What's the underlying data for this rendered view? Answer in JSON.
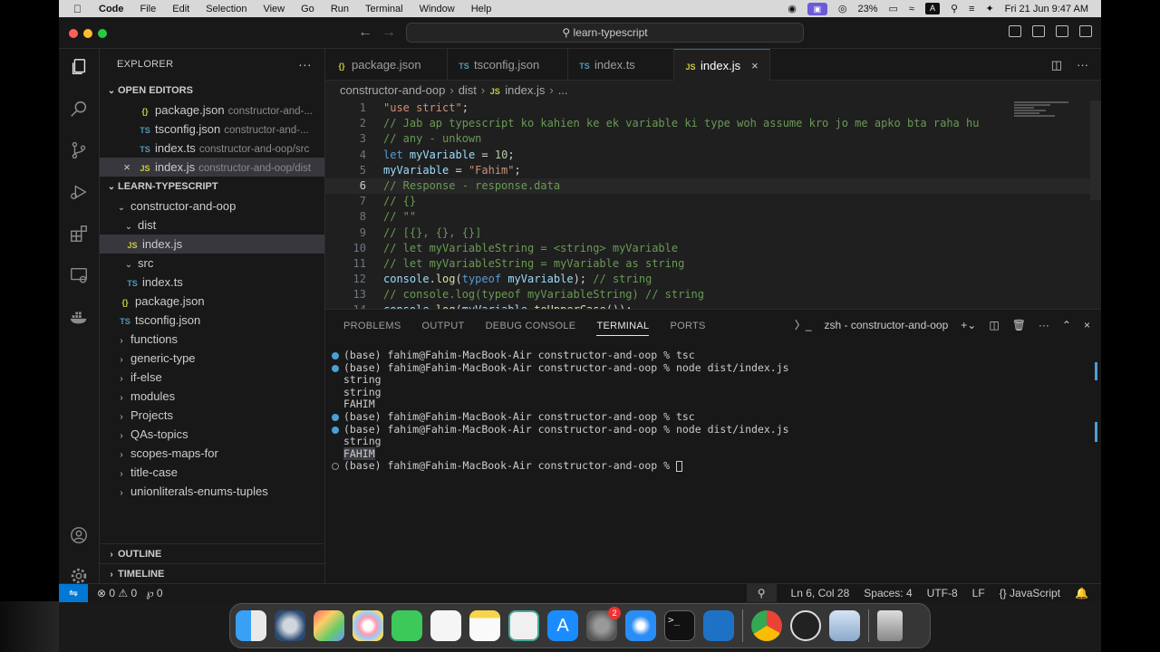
{
  "menubar": {
    "app": "Code",
    "items": [
      "File",
      "Edit",
      "Selection",
      "View",
      "Go",
      "Run",
      "Terminal",
      "Window",
      "Help"
    ],
    "battery": "23%",
    "datetime": "Fri 21 Jun  9:47 AM",
    "input_source": "A"
  },
  "titlebar": {
    "search": "learn-typescript"
  },
  "sidebar": {
    "title": "EXPLORER",
    "open_editors_label": "OPEN EDITORS",
    "open_editors": [
      {
        "icon": "{}",
        "name": "package.json",
        "desc": "constructor-and-..."
      },
      {
        "icon": "TS",
        "name": "tsconfig.json",
        "desc": "constructor-and-..."
      },
      {
        "icon": "TS",
        "name": "index.ts",
        "desc": "constructor-and-oop/src"
      },
      {
        "icon": "JS",
        "name": "index.js",
        "desc": "constructor-and-oop/dist"
      }
    ],
    "workspace_label": "LEARN-TYPESCRIPT",
    "tree": {
      "folder1": "constructor-and-oop",
      "dist": "dist",
      "dist_file": "index.js",
      "src": "src",
      "src_file": "index.ts",
      "pkg": "package.json",
      "tsconfig": "tsconfig.json",
      "folders": [
        "functions",
        "generic-type",
        "if-else",
        "modules",
        "Projects",
        "QAs-topics",
        "scopes-maps-for",
        "title-case",
        "unionliterals-enums-tuples"
      ]
    },
    "outline": "OUTLINE",
    "timeline": "TIMELINE"
  },
  "tabs": [
    {
      "icon": "{}",
      "label": "package.json"
    },
    {
      "icon": "TS",
      "label": "tsconfig.json"
    },
    {
      "icon": "TS",
      "label": "index.ts"
    },
    {
      "icon": "JS",
      "label": "index.js"
    }
  ],
  "breadcrumb": [
    "constructor-and-oop",
    "dist",
    "index.js",
    "..."
  ],
  "code_lines": [
    "\"use strict\";",
    "// Jab ap typescript ko kahien ke ek variable ki type woh assume kro jo me apko bta raha hu",
    "// any - unkown",
    "let myVariable = 10;",
    "myVariable = \"Fahim\";",
    "// Response - response.data",
    "// {}",
    "// \"\"",
    "// [{}, {}, {}]",
    "// let myVariableString = <string> myVariable",
    "// let myVariableString = myVariable as string",
    "console.log(typeof myVariable); // string",
    "// console.log(typeof myVariableString) // string",
    "console.log(myVariable.toUpperCase());"
  ],
  "current_line": 6,
  "panel": {
    "tabs": [
      "PROBLEMS",
      "OUTPUT",
      "DEBUG CONSOLE",
      "TERMINAL",
      "PORTS"
    ],
    "active": "TERMINAL",
    "shell": "zsh - constructor-and-oop",
    "lines": [
      {
        "dot": "filled",
        "text": "(base) fahim@Fahim-MacBook-Air constructor-and-oop % tsc"
      },
      {
        "dot": "filled",
        "text": "(base) fahim@Fahim-MacBook-Air constructor-and-oop % node dist/index.js"
      },
      {
        "dot": "",
        "text": "string"
      },
      {
        "dot": "",
        "text": "string"
      },
      {
        "dot": "",
        "text": "FAHIM"
      },
      {
        "dot": "filled",
        "text": "(base) fahim@Fahim-MacBook-Air constructor-and-oop % tsc"
      },
      {
        "dot": "filled",
        "text": "(base) fahim@Fahim-MacBook-Air constructor-and-oop % node dist/index.js"
      },
      {
        "dot": "",
        "text": "string"
      },
      {
        "dot": "",
        "text": "FAHIM"
      },
      {
        "dot": "hollow",
        "text": "(base) fahim@Fahim-MacBook-Air constructor-and-oop % "
      }
    ]
  },
  "status": {
    "errors": "0",
    "warnings": "0",
    "ports": "0",
    "position": "Ln 6, Col 28",
    "spaces": "Spaces: 4",
    "encoding": "UTF-8",
    "eol": "LF",
    "language": "JavaScript",
    "language_icon": "{}"
  },
  "dock": {
    "settings_badge": "2",
    "apps": [
      "finder",
      "quicktime",
      "launchpad",
      "photos",
      "facetime",
      "reminders",
      "notes",
      "freeform",
      "app-store",
      "system-settings",
      "safari",
      "terminal",
      "vscode",
      "chrome",
      "obs",
      "preview",
      "trash"
    ]
  },
  "colors": {
    "accent": "#0078d4",
    "editor_bg": "#1f1f1f",
    "sidebar_bg": "#181818"
  }
}
